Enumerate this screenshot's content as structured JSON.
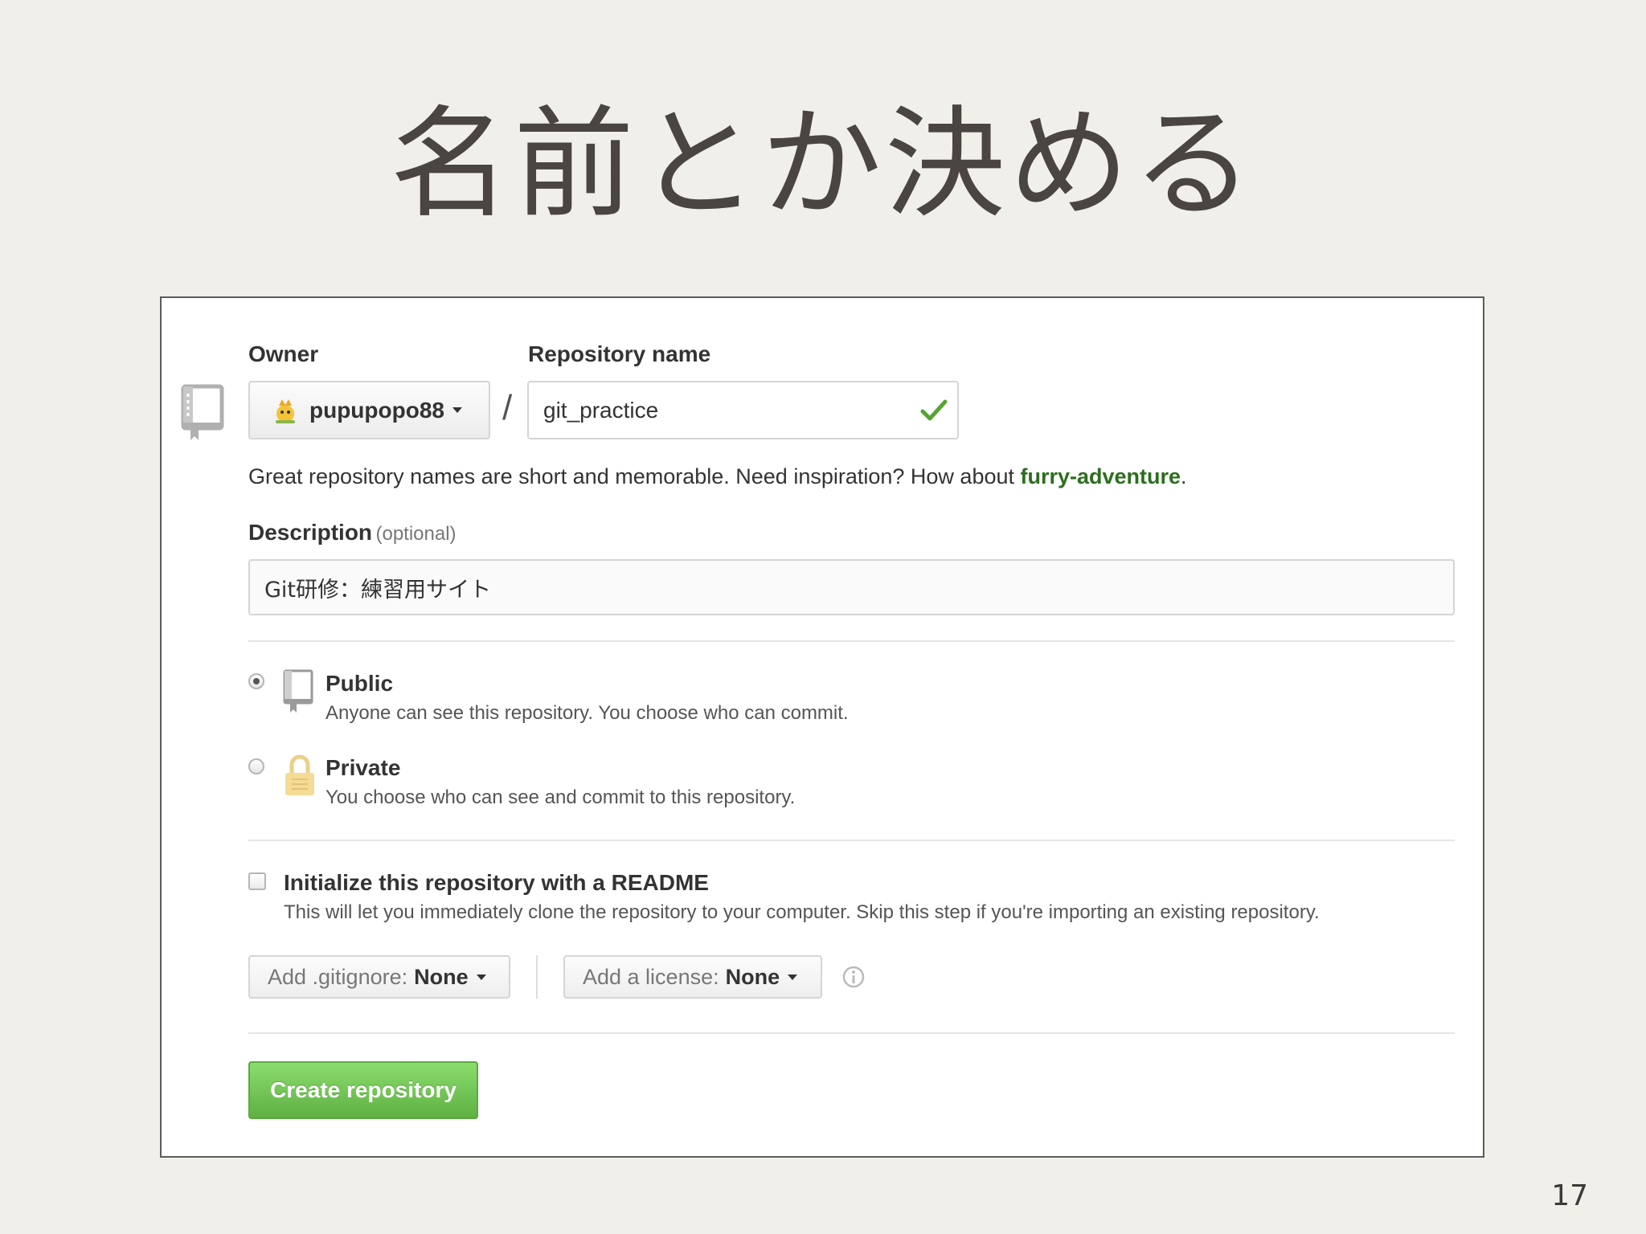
{
  "slide": {
    "title": "名前とか決める",
    "page_number": "17"
  },
  "form": {
    "owner_label": "Owner",
    "owner_value": "pupupopo88",
    "separator": "/",
    "repo_label": "Repository name",
    "repo_value": "git_practice",
    "hint_text": "Great repository names are short and memorable. Need inspiration? How about ",
    "hint_suggestion": "furry-adventure",
    "hint_period": ".",
    "description_label": "Description",
    "description_optional": "(optional)",
    "description_value": "Git研修：練習用サイト",
    "visibility": {
      "public_title": "Public",
      "public_desc": "Anyone can see this repository. You choose who can commit.",
      "private_title": "Private",
      "private_desc": "You choose who can see and commit to this repository.",
      "selected": "public"
    },
    "readme": {
      "title": "Initialize this repository with a README",
      "desc": "This will let you immediately clone the repository to your computer. Skip this step if you're importing an existing repository.",
      "checked": false
    },
    "gitignore_prefix": "Add .gitignore:",
    "gitignore_value": "None",
    "license_prefix": "Add a license:",
    "license_value": "None",
    "create_button": "Create repository"
  },
  "colors": {
    "success_green": "#55a532",
    "suggestion_green": "#2c6e1e",
    "button_green": "#60b044"
  },
  "icons": [
    "repo-book-icon",
    "owner-avatar-icon",
    "check-icon",
    "public-repo-icon",
    "private-lock-icon",
    "info-icon"
  ]
}
